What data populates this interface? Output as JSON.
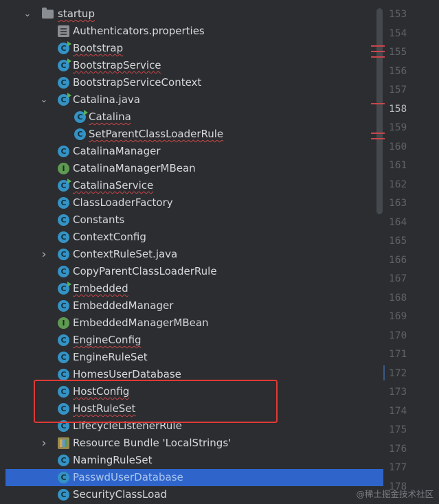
{
  "tree": {
    "items": [
      {
        "label": "startup",
        "kind": "folder",
        "chevron": "expanded",
        "indent": 1
      },
      {
        "label": "Authenticators.properties",
        "kind": "properties",
        "indent": 2
      },
      {
        "label": "Bootstrap",
        "kind": "class-runnable",
        "indent": 2
      },
      {
        "label": "BootstrapService",
        "kind": "class-runnable",
        "indent": 2
      },
      {
        "label": "BootstrapServiceContext",
        "kind": "class",
        "indent": 2
      },
      {
        "label": "Catalina.java",
        "kind": "class-runnable",
        "chevron": "expanded",
        "indent": 2
      },
      {
        "label": "Catalina",
        "kind": "class-runnable",
        "indent": 3
      },
      {
        "label": "SetParentClassLoaderRule",
        "kind": "class",
        "indent": 3
      },
      {
        "label": "CatalinaManager",
        "kind": "class",
        "indent": 2
      },
      {
        "label": "CatalinaManagerMBean",
        "kind": "interface",
        "indent": 2
      },
      {
        "label": "CatalinaService",
        "kind": "class-runnable",
        "indent": 2
      },
      {
        "label": "ClassLoaderFactory",
        "kind": "class",
        "indent": 2
      },
      {
        "label": "Constants",
        "kind": "class",
        "indent": 2
      },
      {
        "label": "ContextConfig",
        "kind": "class",
        "indent": 2
      },
      {
        "label": "ContextRuleSet.java",
        "kind": "class",
        "chevron": "collapsed",
        "indent": 2
      },
      {
        "label": "CopyParentClassLoaderRule",
        "kind": "class",
        "indent": 2
      },
      {
        "label": "Embedded",
        "kind": "class-runnable",
        "indent": 2
      },
      {
        "label": "EmbeddedManager",
        "kind": "class",
        "indent": 2
      },
      {
        "label": "EmbeddedManagerMBean",
        "kind": "interface",
        "indent": 2
      },
      {
        "label": "EngineConfig",
        "kind": "class",
        "indent": 2
      },
      {
        "label": "EngineRuleSet",
        "kind": "class",
        "indent": 2
      },
      {
        "label": "HomesUserDatabase",
        "kind": "class",
        "indent": 2
      },
      {
        "label": "HostConfig",
        "kind": "class",
        "indent": 2
      },
      {
        "label": "HostRuleSet",
        "kind": "class",
        "indent": 2
      },
      {
        "label": "LifecycleListenerRule",
        "kind": "class",
        "indent": 2
      },
      {
        "label": "Resource Bundle 'LocalStrings'",
        "kind": "bundle",
        "chevron": "collapsed",
        "indent": 2
      },
      {
        "label": "NamingRuleSet",
        "kind": "class",
        "indent": 2
      },
      {
        "label": "PasswdUserDatabase",
        "kind": "class",
        "indent": 2,
        "selected": true
      },
      {
        "label": "SecurityClassLoad",
        "kind": "class",
        "indent": 2
      }
    ]
  },
  "gutter": {
    "line_numbers": [
      "153",
      "154",
      "155",
      "156",
      "157",
      "158",
      "159",
      "160",
      "161",
      "162",
      "163",
      "164",
      "165",
      "166",
      "167",
      "168",
      "169",
      "170",
      "171",
      "172",
      "173",
      "174",
      "175",
      "176",
      "177",
      "178"
    ],
    "current_line": "158"
  },
  "watermark": "@稀土掘金技术社区",
  "colors": {
    "background": "#2b2d30",
    "selection": "#2f65ca",
    "highlight_box": "#e03a37",
    "class_icon": "#3592c4",
    "interface_icon": "#5f9a52"
  }
}
